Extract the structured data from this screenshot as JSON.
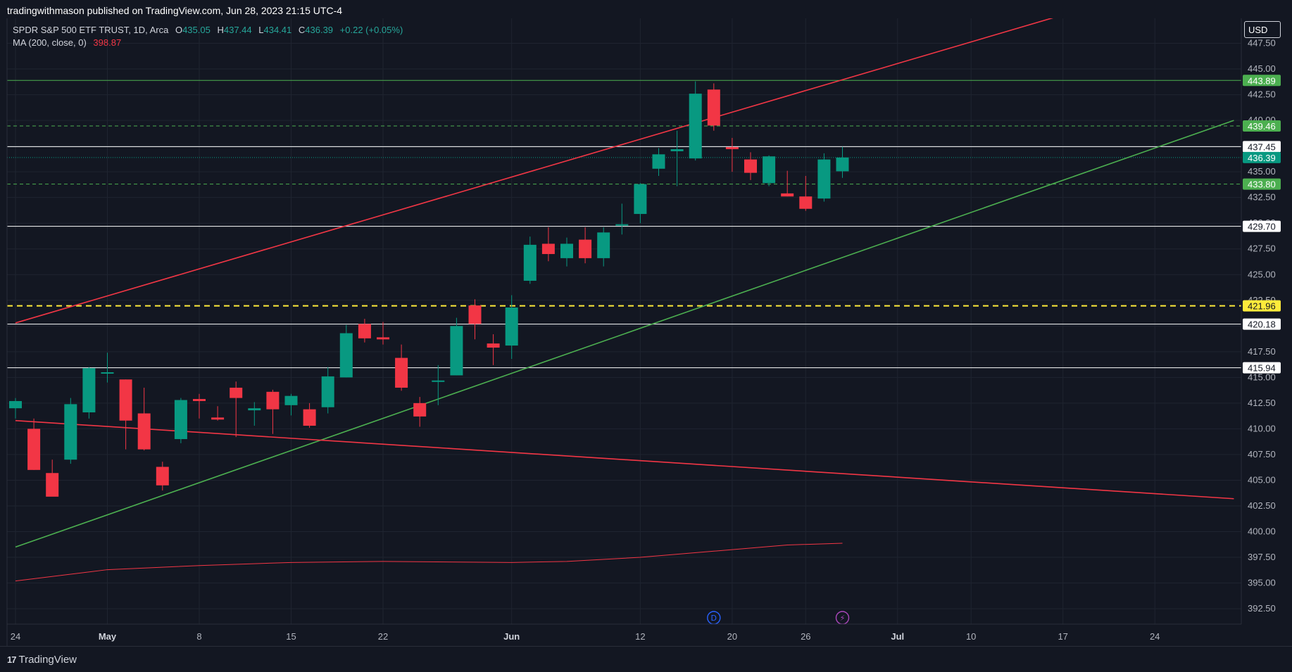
{
  "header": {
    "published_by": "tradingwithmason published on TradingView.com, Jun 28, 2023 21:15 UTC-4"
  },
  "legend": {
    "symbol": "SPDR S&P 500 ETF TRUST, 1D, Arca",
    "o_label": "O",
    "o_value": "435.05",
    "h_label": "H",
    "h_value": "437.44",
    "l_label": "L",
    "l_value": "434.41",
    "c_label": "C",
    "c_value": "436.39",
    "change": "+0.22 (+0.05%)",
    "ma_label": "MA (200, close, 0)",
    "ma_value": "398.87"
  },
  "price_axis": {
    "currency": "USD"
  },
  "footer": {
    "brand": "TradingView",
    "brand_mark": "17"
  },
  "colors": {
    "background": "#131722",
    "grid": "#1f2430",
    "up": "#089981",
    "down": "#f23645",
    "ma": "#f23645",
    "trend_red": "#f23645",
    "trend_green": "#4caf50",
    "level_yellow": "#ffeb3b",
    "level_white": "#ffffff",
    "label_green": "#4caf50",
    "label_current": "#089981"
  },
  "chart_data": {
    "type": "candlestick",
    "symbol": "SPY",
    "interval": "1D",
    "ylim": [
      391,
      450
    ],
    "y_ticks": [
      "392.50",
      "395.00",
      "397.50",
      "400.00",
      "402.50",
      "405.00",
      "407.50",
      "410.00",
      "412.50",
      "415.00",
      "417.50",
      "420.00",
      "422.50",
      "425.00",
      "427.50",
      "430.00",
      "432.50",
      "435.00",
      "437.50",
      "440.00",
      "442.50",
      "445.00",
      "447.50"
    ],
    "x_ticks": [
      {
        "label": "24",
        "index": 0
      },
      {
        "label": "May",
        "index": 5
      },
      {
        "label": "8",
        "index": 10
      },
      {
        "label": "15",
        "index": 15
      },
      {
        "label": "22",
        "index": 20
      },
      {
        "label": "Jun",
        "index": 27
      },
      {
        "label": "12",
        "index": 34
      },
      {
        "label": "20",
        "index": 39
      },
      {
        "label": "26",
        "index": 43
      },
      {
        "label": "Jul",
        "index": 48
      },
      {
        "label": "10",
        "index": 52
      },
      {
        "label": "17",
        "index": 57
      },
      {
        "label": "24",
        "index": 62
      }
    ],
    "candles": [
      {
        "date": "2023-04-24",
        "o": 412.0,
        "h": 413.0,
        "l": 411.0,
        "c": 412.7
      },
      {
        "date": "2023-04-25",
        "o": 410.0,
        "h": 411.0,
        "l": 406.0,
        "c": 406.0
      },
      {
        "date": "2023-04-26",
        "o": 405.7,
        "h": 407.0,
        "l": 404.0,
        "c": 403.4
      },
      {
        "date": "2023-04-27",
        "o": 407.0,
        "h": 413.0,
        "l": 406.6,
        "c": 412.4
      },
      {
        "date": "2023-04-28",
        "o": 411.6,
        "h": 416.0,
        "l": 411.0,
        "c": 415.9
      },
      {
        "date": "2023-05-01",
        "o": 415.5,
        "h": 417.4,
        "l": 414.5,
        "c": 415.5
      },
      {
        "date": "2023-05-02",
        "o": 414.8,
        "h": 414.8,
        "l": 408.0,
        "c": 410.8
      },
      {
        "date": "2023-05-03",
        "o": 411.5,
        "h": 414.0,
        "l": 407.9,
        "c": 408.0
      },
      {
        "date": "2023-05-04",
        "o": 406.3,
        "h": 406.8,
        "l": 404.0,
        "c": 404.5
      },
      {
        "date": "2023-05-05",
        "o": 409.0,
        "h": 413.0,
        "l": 408.6,
        "c": 412.8
      },
      {
        "date": "2023-05-08",
        "o": 412.9,
        "h": 413.4,
        "l": 411.0,
        "c": 412.7
      },
      {
        "date": "2023-05-09",
        "o": 411.1,
        "h": 412.2,
        "l": 410.8,
        "c": 410.9
      },
      {
        "date": "2023-05-10",
        "o": 414.0,
        "h": 414.6,
        "l": 409.2,
        "c": 413.0
      },
      {
        "date": "2023-05-11",
        "o": 411.8,
        "h": 412.6,
        "l": 410.3,
        "c": 412.0
      },
      {
        "date": "2023-05-12",
        "o": 413.6,
        "h": 413.8,
        "l": 409.5,
        "c": 411.9
      },
      {
        "date": "2023-05-15",
        "o": 412.3,
        "h": 413.4,
        "l": 411.3,
        "c": 413.2
      },
      {
        "date": "2023-05-16",
        "o": 411.9,
        "h": 412.5,
        "l": 410.1,
        "c": 410.3
      },
      {
        "date": "2023-05-17",
        "o": 412.1,
        "h": 416.0,
        "l": 411.5,
        "c": 415.1
      },
      {
        "date": "2023-05-18",
        "o": 415.0,
        "h": 420.1,
        "l": 415.0,
        "c": 419.3
      },
      {
        "date": "2023-05-19",
        "o": 420.2,
        "h": 420.7,
        "l": 418.4,
        "c": 418.8
      },
      {
        "date": "2023-05-22",
        "o": 418.9,
        "h": 420.4,
        "l": 418.2,
        "c": 418.7
      },
      {
        "date": "2023-05-23",
        "o": 416.9,
        "h": 418.2,
        "l": 413.7,
        "c": 414.0
      },
      {
        "date": "2023-05-24",
        "o": 412.5,
        "h": 413.1,
        "l": 410.2,
        "c": 411.2
      },
      {
        "date": "2023-05-25",
        "o": 414.7,
        "h": 416.2,
        "l": 412.3,
        "c": 414.7
      },
      {
        "date": "2023-05-26",
        "o": 415.2,
        "h": 420.8,
        "l": 415.2,
        "c": 420.0
      },
      {
        "date": "2023-05-30",
        "o": 422.0,
        "h": 422.6,
        "l": 418.7,
        "c": 420.2
      },
      {
        "date": "2023-05-31",
        "o": 418.3,
        "h": 419.2,
        "l": 416.2,
        "c": 417.9
      },
      {
        "date": "2023-06-01",
        "o": 418.1,
        "h": 423.0,
        "l": 416.8,
        "c": 421.8
      },
      {
        "date": "2023-06-02",
        "o": 424.4,
        "h": 428.7,
        "l": 424.1,
        "c": 427.9
      },
      {
        "date": "2023-06-05",
        "o": 428.0,
        "h": 429.6,
        "l": 426.3,
        "c": 427.0
      },
      {
        "date": "2023-06-06",
        "o": 426.6,
        "h": 428.6,
        "l": 425.8,
        "c": 428.0
      },
      {
        "date": "2023-06-07",
        "o": 428.4,
        "h": 429.6,
        "l": 426.1,
        "c": 426.6
      },
      {
        "date": "2023-06-08",
        "o": 426.6,
        "h": 429.6,
        "l": 425.8,
        "c": 429.1
      },
      {
        "date": "2023-06-09",
        "o": 429.9,
        "h": 431.9,
        "l": 428.9,
        "c": 429.9
      },
      {
        "date": "2023-06-12",
        "o": 430.9,
        "h": 433.9,
        "l": 430.0,
        "c": 433.8
      },
      {
        "date": "2023-06-13",
        "o": 435.3,
        "h": 437.3,
        "l": 434.6,
        "c": 436.7
      },
      {
        "date": "2023-06-14",
        "o": 437.0,
        "h": 439.0,
        "l": 433.6,
        "c": 437.2
      },
      {
        "date": "2023-06-15",
        "o": 436.3,
        "h": 443.8,
        "l": 436.1,
        "c": 442.6
      },
      {
        "date": "2023-06-16",
        "o": 443.0,
        "h": 443.6,
        "l": 439.0,
        "c": 439.5
      },
      {
        "date": "2023-06-20",
        "o": 437.4,
        "h": 438.3,
        "l": 435.0,
        "c": 437.2
      },
      {
        "date": "2023-06-21",
        "o": 436.2,
        "h": 436.9,
        "l": 434.2,
        "c": 434.9
      },
      {
        "date": "2023-06-22",
        "o": 433.9,
        "h": 436.6,
        "l": 433.6,
        "c": 436.5
      },
      {
        "date": "2023-06-23",
        "o": 432.9,
        "h": 435.1,
        "l": 432.6,
        "c": 432.6
      },
      {
        "date": "2023-06-26",
        "o": 432.6,
        "h": 434.6,
        "l": 431.2,
        "c": 431.4
      },
      {
        "date": "2023-06-27",
        "o": 432.4,
        "h": 436.8,
        "l": 432.1,
        "c": 436.2
      },
      {
        "date": "2023-06-28",
        "o": 435.05,
        "h": 437.44,
        "l": 434.41,
        "c": 436.39
      }
    ],
    "moving_average": {
      "label": "MA (200, close, 0)",
      "points": [
        {
          "index": 0,
          "value": 395.2
        },
        {
          "index": 5,
          "value": 396.3
        },
        {
          "index": 10,
          "value": 396.7
        },
        {
          "index": 15,
          "value": 397.0
        },
        {
          "index": 20,
          "value": 397.1
        },
        {
          "index": 27,
          "value": 397.0
        },
        {
          "index": 30,
          "value": 397.1
        },
        {
          "index": 34,
          "value": 397.5
        },
        {
          "index": 38,
          "value": 398.1
        },
        {
          "index": 42,
          "value": 398.7
        },
        {
          "index": 45,
          "value": 398.87
        }
      ]
    },
    "trendlines": [
      {
        "name": "upper-channel",
        "color": "red",
        "from": {
          "index": 0,
          "value": 420.3
        },
        "to": {
          "index": 56.5,
          "value": 450.0
        }
      },
      {
        "name": "lower-channel",
        "color": "green",
        "from": {
          "index": 0,
          "value": 398.5
        },
        "to": {
          "index": 66.3,
          "value": 440.0
        }
      },
      {
        "name": "declining-line",
        "color": "red",
        "from": {
          "index": 0,
          "value": 410.8
        },
        "to": {
          "index": 66.3,
          "value": 403.2
        }
      }
    ],
    "levels": [
      {
        "value": 443.89,
        "label": "443.89",
        "style": "solid",
        "color": "green"
      },
      {
        "value": 439.46,
        "label": "439.46",
        "style": "dashed",
        "color": "green"
      },
      {
        "value": 437.45,
        "label": "437.45",
        "style": "solid",
        "color": "white"
      },
      {
        "value": 436.39,
        "label": "436.39",
        "style": "dotted",
        "color": "current"
      },
      {
        "value": 433.8,
        "label": "433.80",
        "style": "dashed",
        "color": "green"
      },
      {
        "value": 429.7,
        "label": "429.70",
        "style": "solid",
        "color": "white"
      },
      {
        "value": 421.96,
        "label": "421.96",
        "style": "dashed",
        "color": "yellow"
      },
      {
        "value": 420.18,
        "label": "420.18",
        "style": "solid",
        "color": "white"
      },
      {
        "value": 415.94,
        "label": "415.94",
        "style": "solid",
        "color": "white"
      }
    ],
    "events": [
      {
        "type": "dividend",
        "label": "D",
        "index": 38
      },
      {
        "type": "earnings",
        "label": "⚡",
        "index": 45
      }
    ]
  }
}
